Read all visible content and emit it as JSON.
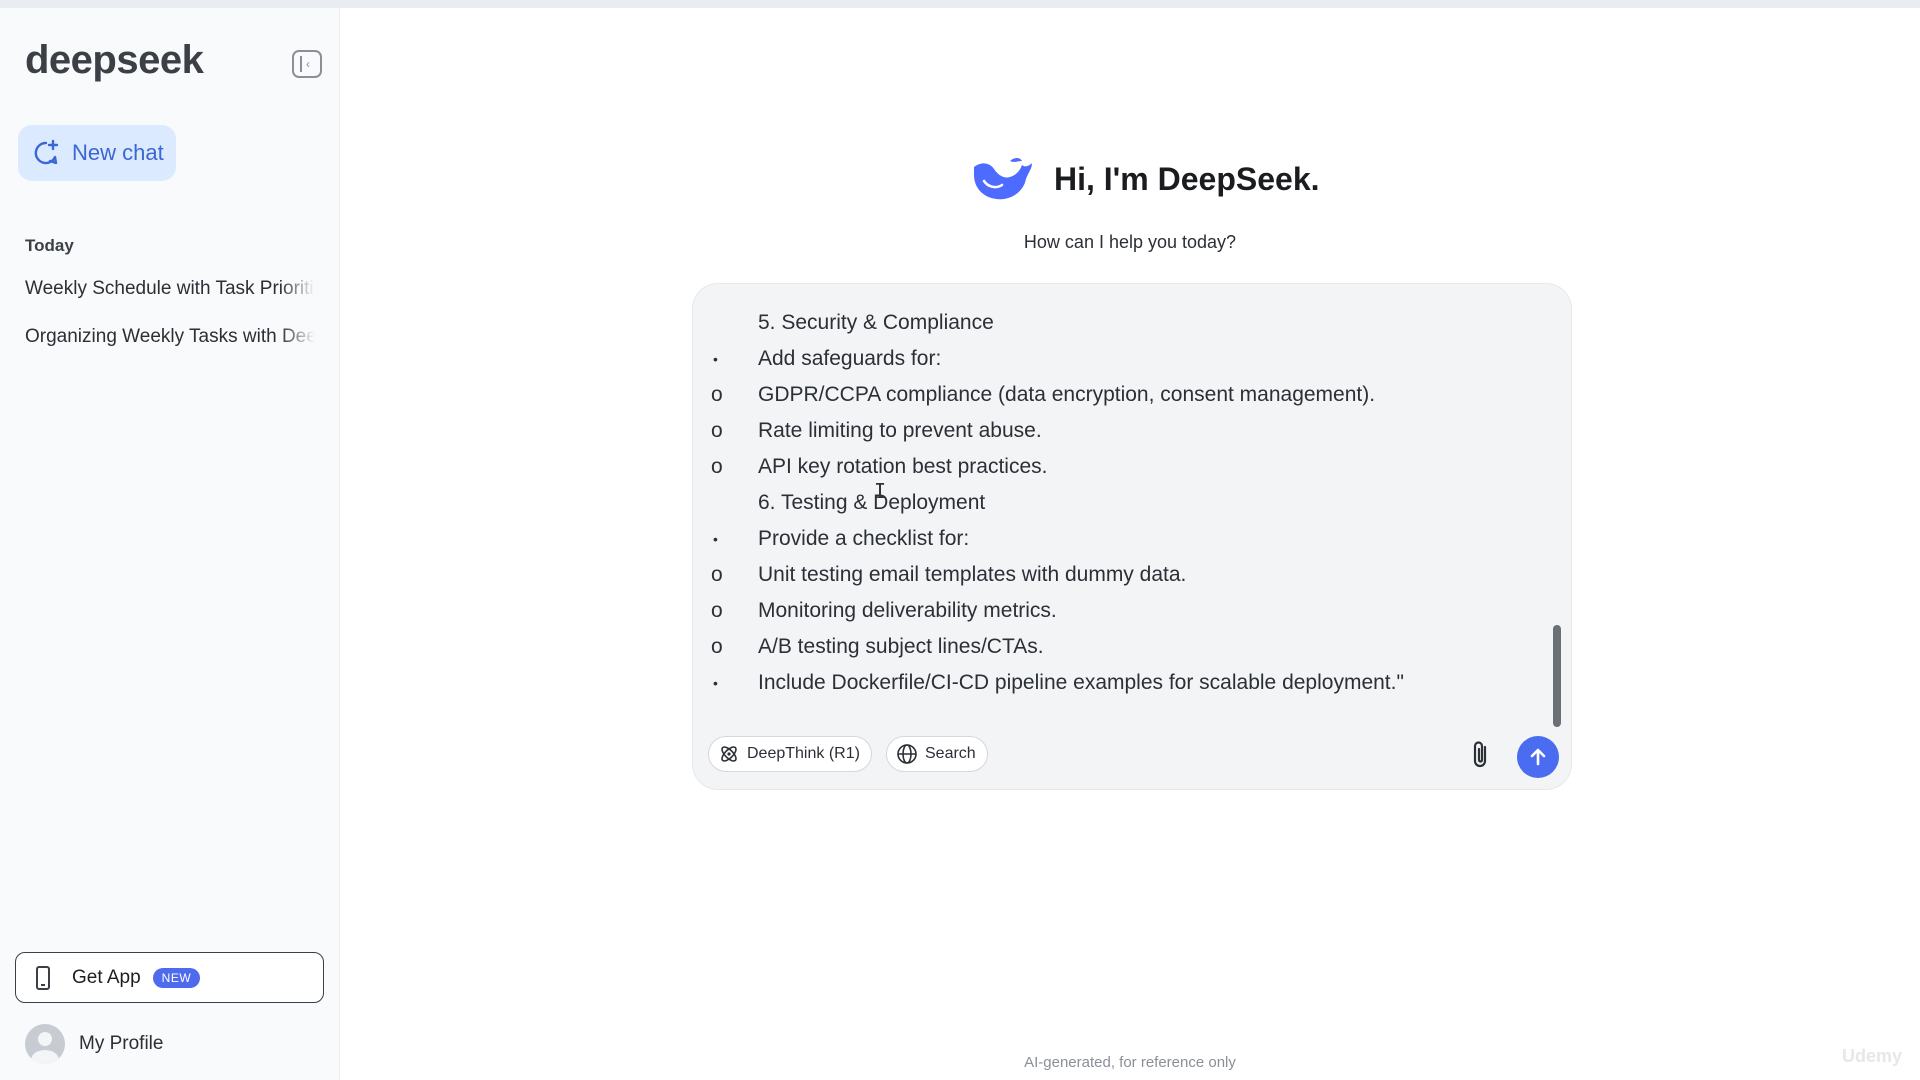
{
  "app": {
    "logo": "deepseek"
  },
  "sidebar": {
    "new_chat_label": "New chat",
    "section_today": "Today",
    "history": [
      "Weekly Schedule with Task Prioritization",
      "Organizing Weekly Tasks with DeepSeek"
    ],
    "get_app_label": "Get App",
    "get_app_badge": "NEW",
    "profile_label": "My Profile"
  },
  "main": {
    "greeting": "Hi, I'm DeepSeek.",
    "subtitle": "How can I help you today?",
    "disclaimer": "AI-generated, for reference only"
  },
  "composer": {
    "lines": [
      {
        "mark": "",
        "text": "5. Security & Compliance"
      },
      {
        "mark": "•",
        "text": "Add safeguards for:"
      },
      {
        "mark": "o",
        "text": "GDPR/CCPA compliance (data encryption, consent management)."
      },
      {
        "mark": "o",
        "text": "Rate limiting to prevent abuse."
      },
      {
        "mark": "o",
        "text": "API key rotation best practices."
      },
      {
        "mark": "",
        "text": "6. Testing & Deployment"
      },
      {
        "mark": "•",
        "text": "Provide a checklist for:"
      },
      {
        "mark": "o",
        "text": "Unit testing email templates with dummy data."
      },
      {
        "mark": "o",
        "text": "Monitoring deliverability metrics."
      },
      {
        "mark": "o",
        "text": "A/B testing subject lines/CTAs."
      },
      {
        "mark": "•",
        "text": "Include Dockerfile/CI-CD pipeline examples for scalable deployment.\""
      }
    ],
    "deepthink_label": "DeepThink (R1)",
    "search_label": "Search"
  },
  "watermark": "Udemy",
  "colors": {
    "accent": "#4a6cf0",
    "new_chat_bg": "#dbeafe",
    "new_chat_text": "#3b67d6"
  }
}
